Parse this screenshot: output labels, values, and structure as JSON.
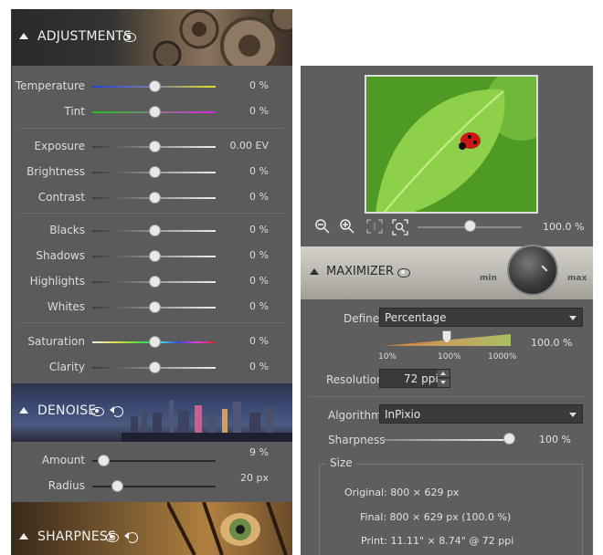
{
  "left": {
    "adjustments": {
      "title": "ADJUSTMENTS",
      "icon": "eye-icon"
    },
    "sliders": [
      {
        "label": "Temperature",
        "value": "0 %",
        "level": 0.5,
        "style": "temp"
      },
      {
        "label": "Tint",
        "value": "0 %",
        "level": 0.5,
        "style": "tint"
      },
      {
        "label": "Exposure",
        "value": "0.00 EV",
        "level": 0.5,
        "style": "gray"
      },
      {
        "label": "Brightness",
        "value": "0 %",
        "level": 0.5,
        "style": "gray"
      },
      {
        "label": "Contrast",
        "value": "0 %",
        "level": 0.5,
        "style": "gray"
      },
      {
        "label": "Blacks",
        "value": "0 %",
        "level": 0.5,
        "style": "gray"
      },
      {
        "label": "Shadows",
        "value": "0 %",
        "level": 0.5,
        "style": "gray"
      },
      {
        "label": "Highlights",
        "value": "0 %",
        "level": 0.5,
        "style": "gray"
      },
      {
        "label": "Whites",
        "value": "0 %",
        "level": 0.5,
        "style": "gray"
      },
      {
        "label": "Saturation",
        "value": "0 %",
        "level": 0.5,
        "style": "sat"
      },
      {
        "label": "Clarity",
        "value": "0 %",
        "level": 0.5,
        "style": "gray"
      }
    ],
    "denoise": {
      "title": "DENOISE"
    },
    "denoise_sliders": [
      {
        "label": "Amount",
        "value": "9 %",
        "level": 0.09
      },
      {
        "label": "Radius",
        "value": "20 px",
        "level": 0.2
      }
    ],
    "sharpness": {
      "title": "SHARPNESS"
    }
  },
  "right": {
    "zoom": {
      "value": "100.0 %",
      "level": 0.5
    },
    "maximizer": {
      "title": "MAXIMIZER",
      "knob_min": "min",
      "knob_max": "max"
    },
    "define": {
      "label": "Define",
      "selected": "Percentage"
    },
    "scale": {
      "marks": [
        "10%",
        "100%",
        "1000%"
      ],
      "value": "100.0 %",
      "level": 0.5
    },
    "resolution": {
      "label": "Resolution",
      "value": "72 ppi"
    },
    "algorithm": {
      "label": "Algorithm",
      "selected": "InPixio"
    },
    "sharpness": {
      "label": "Sharpness",
      "value": "100 %",
      "level": 1.0
    },
    "size": {
      "title": "Size",
      "original": "Original: 800 × 629 px",
      "final": "Final: 800 × 629 px (100.0 %)",
      "print": "Print: 11.11\" × 8.74\" @ 72 ppi"
    }
  }
}
